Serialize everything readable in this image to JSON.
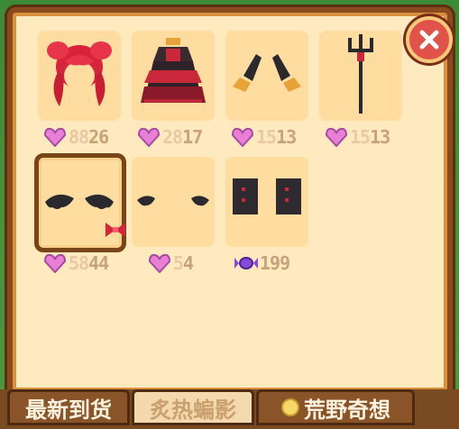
{
  "items": [
    {
      "name": "red-twin-tail-hair",
      "price": "26",
      "price_faded": "88",
      "currency": "heart"
    },
    {
      "name": "gothic-red-black-dress",
      "price": "17",
      "price_faded": "28",
      "currency": "heart"
    },
    {
      "name": "bat-arm-cuffs",
      "price": "13",
      "price_faded": "15",
      "currency": "heart"
    },
    {
      "name": "dark-trident",
      "price": "13",
      "price_faded": "15",
      "currency": "heart"
    },
    {
      "name": "bat-wings-selected",
      "price": "44",
      "price_faded": "58",
      "currency": "heart"
    },
    {
      "name": "small-bat-wings",
      "price": "4",
      "price_faded": "5",
      "currency": "heart"
    },
    {
      "name": "dark-boots",
      "price": "199",
      "price_faded": "",
      "currency": "candy"
    }
  ],
  "tabs": [
    {
      "label": "最新到货",
      "active": false
    },
    {
      "label": "炙热蝙影",
      "active": true
    },
    {
      "label": "荒野奇想",
      "active": false
    }
  ],
  "colors": {
    "frame": "#8a4a1e",
    "panel": "#ffe9bf",
    "cell": "#ffdca0",
    "heart": "#e880d8",
    "close": "#e0524a"
  }
}
